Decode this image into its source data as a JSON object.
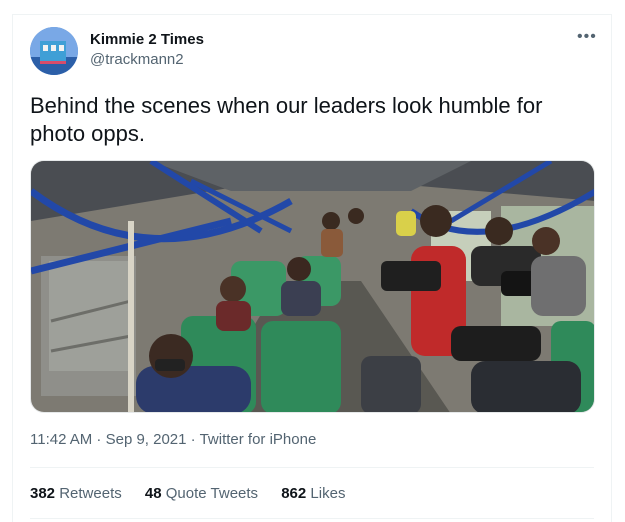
{
  "tweet": {
    "author_name": "Kimmie 2 Times",
    "author_handle": "@trackmann2",
    "more_icon": "ellipsis-icon",
    "text": "Behind the scenes when our leaders look humble for photo opps.",
    "timestamp": "11:42 AM · Sep 9, 2021",
    "separator": " · ",
    "source": "Twitter for iPhone",
    "stats": {
      "retweets_count": "382",
      "retweets_label": "Retweets",
      "quote_tweets_count": "48",
      "quote_tweets_label": "Quote Tweets",
      "likes_count": "862",
      "likes_label": "Likes"
    }
  },
  "colors": {
    "text_primary": "#0f1419",
    "text_secondary": "#536471",
    "divider": "#eff3f4"
  }
}
